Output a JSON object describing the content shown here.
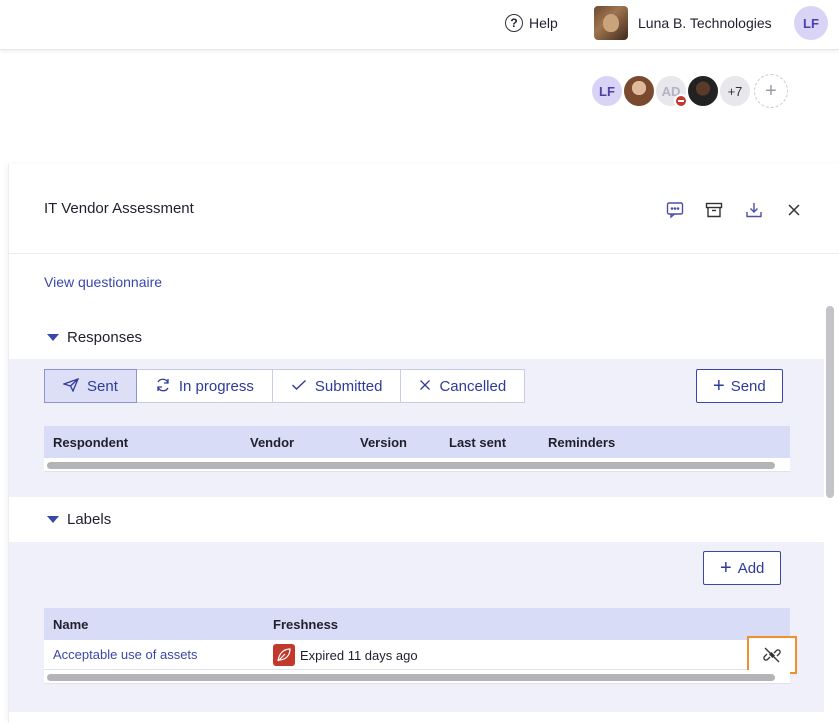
{
  "header": {
    "help_label": "Help",
    "org_name": "Luna B. Technologies",
    "user_initials": "LF"
  },
  "collaborators": {
    "first_initials": "LF",
    "third_initials": "AD",
    "more_count": "+7",
    "add_symbol": "+"
  },
  "panel": {
    "title": "IT Vendor Assessment",
    "view_questionnaire": "View questionnaire"
  },
  "responses": {
    "section_title": "Responses",
    "filters": [
      {
        "label": "Sent",
        "icon": "paper-plane-icon",
        "active": true
      },
      {
        "label": "In progress",
        "icon": "refresh-icon",
        "active": false
      },
      {
        "label": "Submitted",
        "icon": "check-icon",
        "active": false
      },
      {
        "label": "Cancelled",
        "icon": "x-icon",
        "active": false
      }
    ],
    "send_label": "Send",
    "columns": [
      "Respondent",
      "Vendor",
      "Version",
      "Last sent",
      "Reminders"
    ]
  },
  "labels": {
    "section_title": "Labels",
    "add_label": "Add",
    "columns": [
      "Name",
      "Freshness"
    ],
    "rows": [
      {
        "name": "Acceptable use of assets",
        "freshness": "Expired 11 days ago"
      }
    ]
  },
  "colors": {
    "accent": "#3b47a8",
    "band": "#eff0fa",
    "table_header": "#d9dcf6",
    "expired": "#c0392b",
    "focus": "#f0902a"
  }
}
